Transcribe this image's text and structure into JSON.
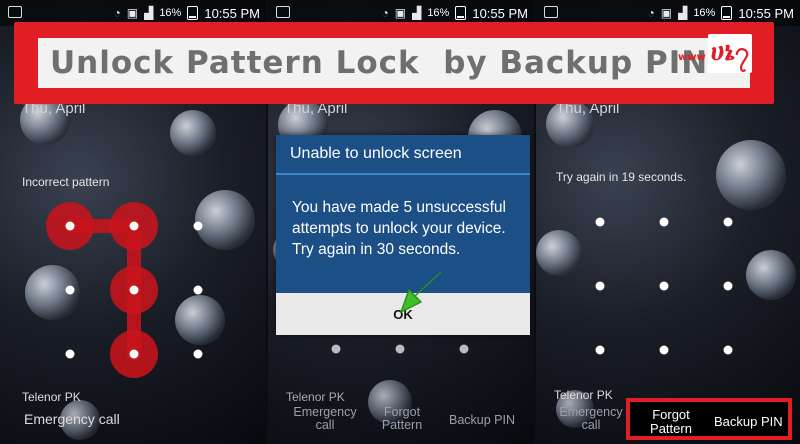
{
  "banner": {
    "title": "Unlock Pattern Lock  by Backup PIN",
    "logo_small": "www",
    "logo_main": "ሀኔ၇"
  },
  "status_bar": {
    "battery": "16%",
    "time": "10:55 PM"
  },
  "phones": [
    {
      "date": "Thu, April",
      "message": "Incorrect pattern",
      "carrier": "Telenor PK",
      "emergency": "Emergency call"
    },
    {
      "date": "Thu, April",
      "carrier": "Telenor PK",
      "emergency": "Emergency call",
      "forgot": "Forgot Pattern",
      "backup": "Backup PIN"
    },
    {
      "date": "Thu, April",
      "message": "Try again in 19 seconds.",
      "carrier": "Telenor PK",
      "emergency": "Emergency call",
      "forgot": "Forgot Pattern",
      "backup": "Backup PIN"
    }
  ],
  "dialog": {
    "title": "Unable to unlock screen",
    "body": "You have made 5 unsuccessful attempts to unlock your device. Try again in 30 seconds.",
    "ok": "OK"
  },
  "colors": {
    "banner_red": "#e01e24",
    "dialog_blue": "#1c4f86",
    "pattern_red": "#c8141c",
    "arrow_green": "#3fbf2a"
  }
}
